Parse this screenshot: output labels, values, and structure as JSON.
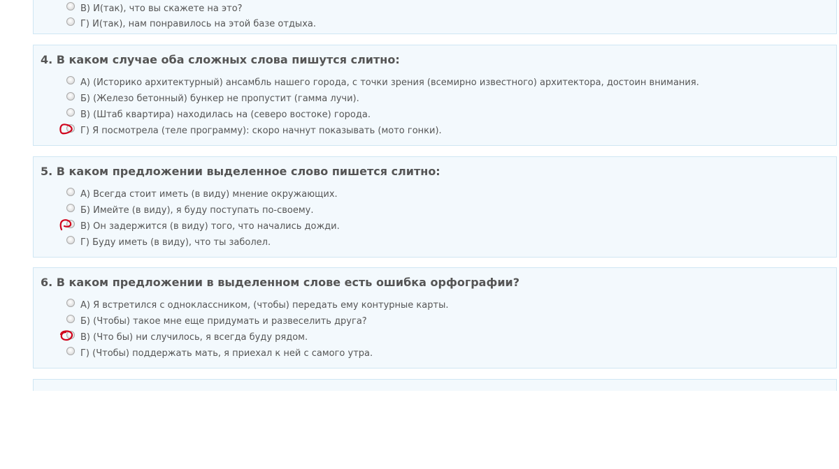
{
  "quiz": {
    "q3": {
      "options": [
        {
          "label": "В) И(так), что вы скажете на это?",
          "selected": false,
          "marked": false
        },
        {
          "label": "Г) И(так), нам понравилось на этой базе отдыха.",
          "selected": false,
          "marked": false
        }
      ]
    },
    "q4": {
      "title": "4. В каком случае оба сложных слова пишутся слитно:",
      "options": [
        {
          "label": "А) (Историко архитектурный) ансамбль нашего города, с точки зрения (всемирно известного) архитектора, достоин внимания.",
          "selected": false,
          "marked": false
        },
        {
          "label": "Б) (Железо бетонный) бункер не пропустит (гамма лучи).",
          "selected": false,
          "marked": false
        },
        {
          "label": "В) (Штаб квартира) находилась на (северо востоке) города.",
          "selected": false,
          "marked": false
        },
        {
          "label": "Г) Я посмотрела (теле программу): скоро начнут показывать (мото гонки).",
          "selected": false,
          "marked": true
        }
      ]
    },
    "q5": {
      "title": "5. В каком предложении выделенное слово пишется слитно:",
      "options": [
        {
          "label": "А) Всегда стоит иметь (в виду) мнение окружающих.",
          "selected": false,
          "marked": false
        },
        {
          "label": "Б) Имейте (в виду), я буду поступать по-своему.",
          "selected": false,
          "marked": false
        },
        {
          "label": "В) Он задержится (в виду) того, что начались дожди.",
          "selected": false,
          "marked": true
        },
        {
          "label": "Г) Буду иметь (в виду), что ты заболел.",
          "selected": false,
          "marked": false
        }
      ]
    },
    "q6": {
      "title": "6. В каком предложении в выделенном слове есть ошибка орфографии?",
      "options": [
        {
          "label": "А) Я встретился с одноклассником, (чтобы) передать ему контурные карты.",
          "selected": false,
          "marked": false
        },
        {
          "label": "Б) (Чтобы) такое мне еще придумать и развеселить друга?",
          "selected": false,
          "marked": false
        },
        {
          "label": "В) (Что бы) ни случилось, я всегда буду рядом.",
          "selected": false,
          "marked": true
        },
        {
          "label": "Г) (Чтобы) поддержать мать, я приехал к ней с самого утра.",
          "selected": false,
          "marked": false
        }
      ]
    }
  },
  "colors": {
    "card_background": "#f3f9fd",
    "card_border": "#cfe6f3",
    "text": "#555555",
    "annotation_red": "#d0021b"
  }
}
